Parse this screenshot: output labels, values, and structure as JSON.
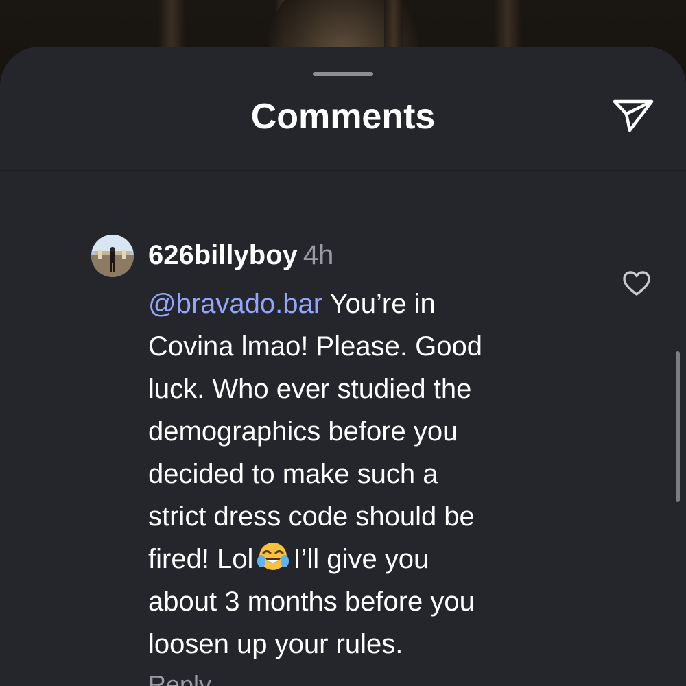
{
  "sheet": {
    "title": "Comments",
    "icons": {
      "share": "paper-plane-icon",
      "like": "heart-outline-icon",
      "grabber": "drag-handle"
    }
  },
  "comment": {
    "username": "626billyboy",
    "time": "4h",
    "mention": "@bravado.bar",
    "lines": {
      "l1": " You’re in",
      "l2": "Covina lmao! Please. Good",
      "l3": "luck. Who ever studied the",
      "l4": "demographics before you",
      "l5": "decided to make such a",
      "l6": "strict dress code should be",
      "l7a": "fired! Lol",
      "l7b": "I’ll give you",
      "l8": "about 3 months before you",
      "l9": "loosen up your rules."
    },
    "emoji": "face-with-tears-of-joy-emoji",
    "reply_label": "Reply"
  },
  "colors": {
    "sheet_background": "#25262b",
    "text_primary": "#ffffff",
    "text_secondary": "#9b9ca3",
    "mention": "#93a6ff"
  }
}
